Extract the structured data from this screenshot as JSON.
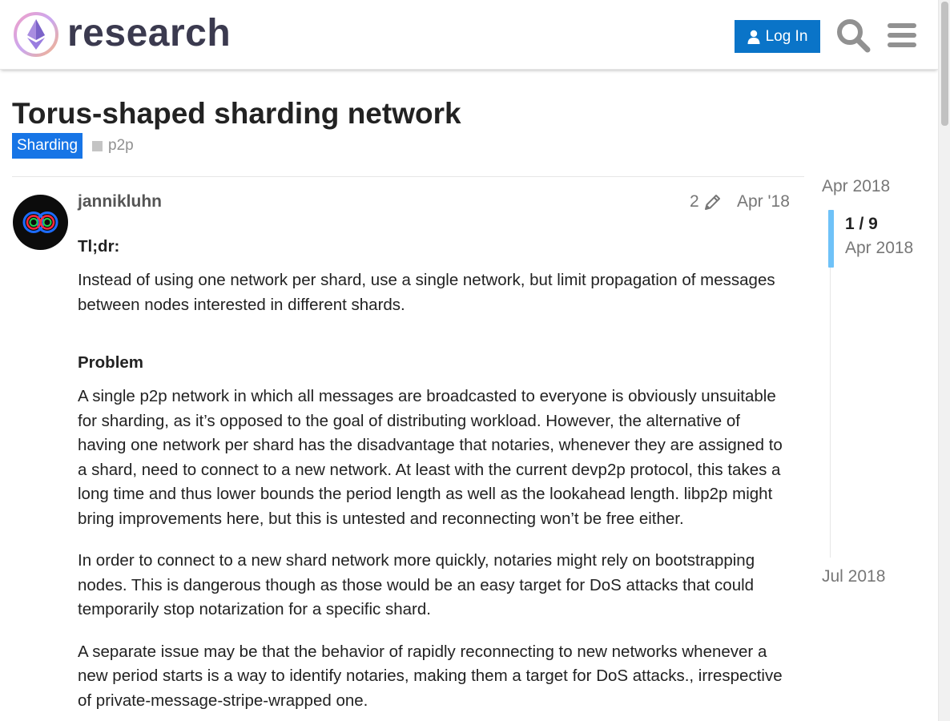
{
  "header": {
    "logo_text": "research",
    "login_label": "Log In",
    "colors": {
      "primary": "#0a74c8",
      "logo_text": "#3b3a4f"
    }
  },
  "topic": {
    "title": "Torus-shaped sharding network",
    "category": "Sharding",
    "category_color": "#1775e6",
    "tags": [
      "p2p"
    ]
  },
  "post": {
    "username": "jannikluhn",
    "edit_count": "2",
    "date": "Apr '18",
    "tldr_heading": "Tl;dr:",
    "tldr": "Instead of using one network per shard, use a single network, but limit propagation of messages between nodes interested in different shards.",
    "problem_heading": "Problem",
    "paragraphs": [
      "A single p2p network in which all messages are broadcasted to everyone is obviously unsuitable for sharding, as it’s opposed to the goal of distributing workload. However, the alternative of having one network per shard has the disadvantage that notaries, whenever they are assigned to a shard, need to connect to a new network. At least with the current devp2p protocol, this takes a long time and thus lower bounds the period length as well as the lookahead length. libp2p might bring improvements here, but this is untested and reconnecting won’t be free either.",
      "In order to connect to a new shard network more quickly, notaries might rely on bootstrapping nodes. This is dangerous though as those would be an easy target for DoS attacks that could temporarily stop notarization for a specific shard.",
      "A separate issue may be that the behavior of rapidly reconnecting to new networks whenever a new period starts is a way to identify notaries, making them a target for DoS attacks., irrespective of private-message-stripe-wrapped one."
    ]
  },
  "timeline": {
    "start_date": "Apr 2018",
    "position": "1 / 9",
    "position_date": "Apr 2018",
    "end_date": "Jul 2018"
  }
}
